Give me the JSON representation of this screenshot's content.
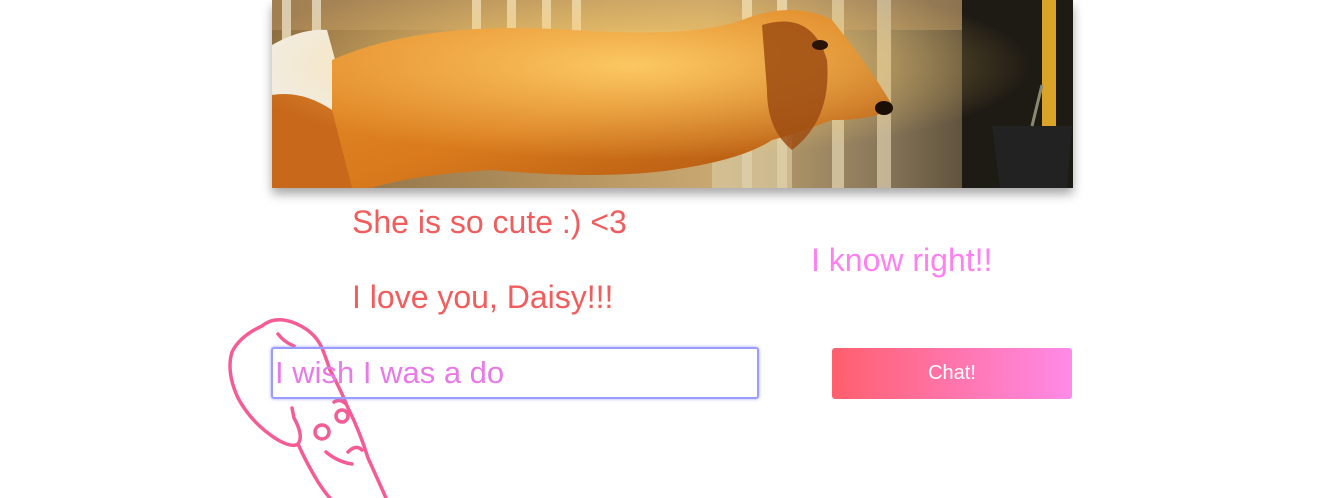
{
  "photo": {
    "alt_icon": "dog-photo"
  },
  "messages": {
    "me": [
      "She is so cute :) <3",
      "I love you, Daisy!!!"
    ],
    "other": [
      "I know right!!"
    ]
  },
  "composer": {
    "input_value": "I wish I was a do",
    "button_label": "Chat!"
  },
  "colors": {
    "me_text": "#f25c5c",
    "other_text": "#ff80f0",
    "input_text": "#e87ae8",
    "input_border": "#9a9cff",
    "button_gradient_start": "#ff5f6d",
    "button_gradient_end": "#ff8ae8",
    "doodle_stroke": "#f55c96"
  },
  "icons": {
    "doodle": "dog-doodle-icon"
  }
}
